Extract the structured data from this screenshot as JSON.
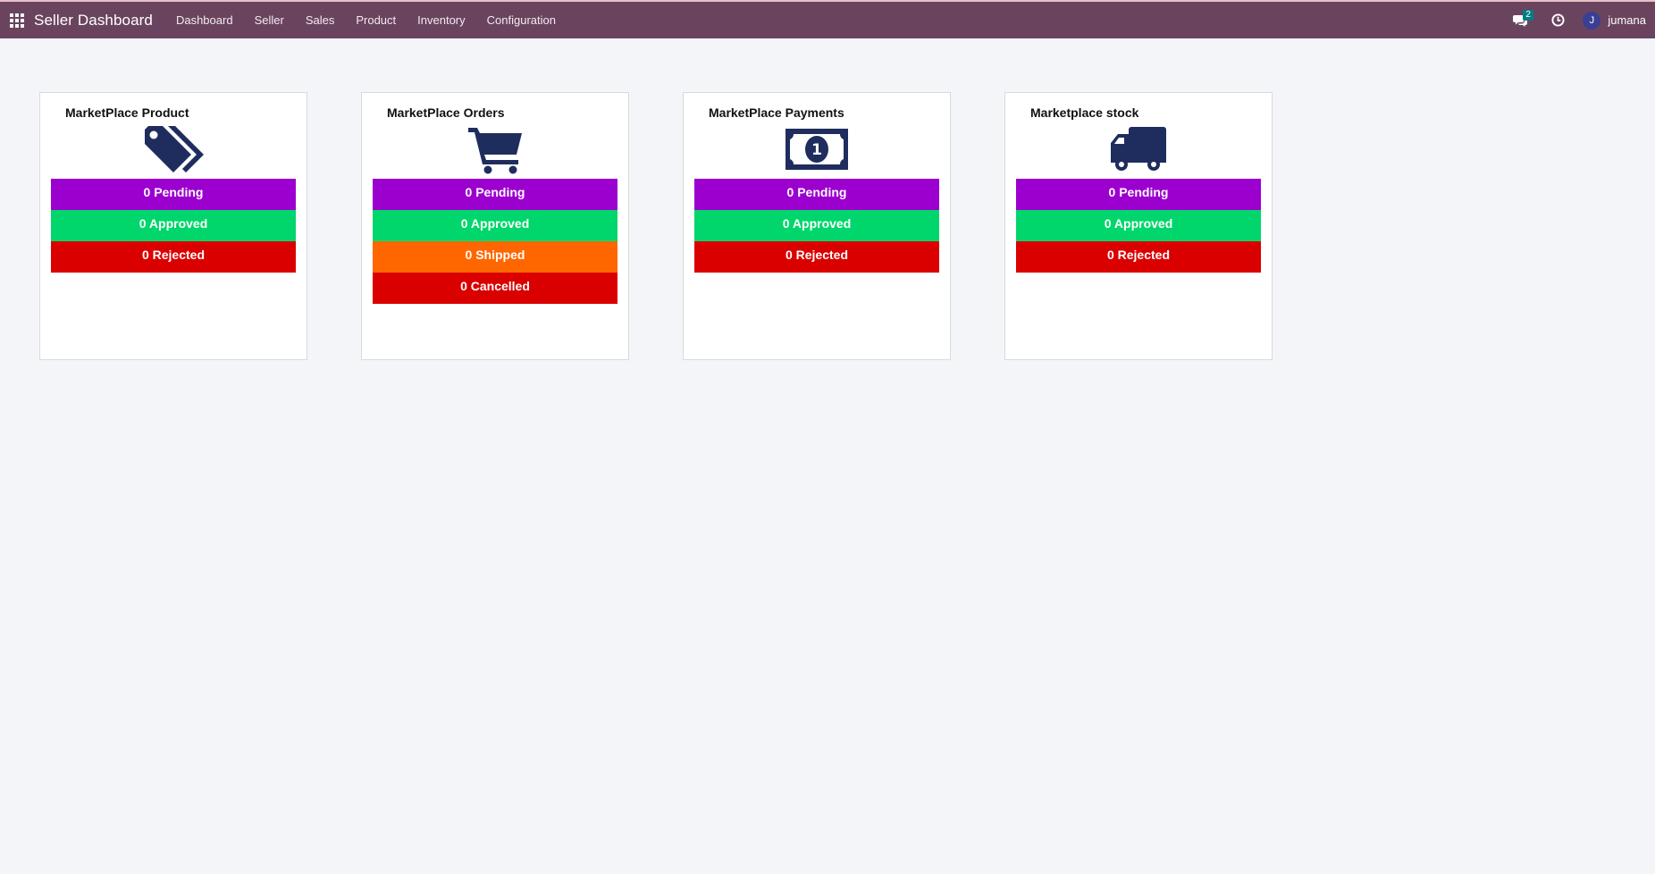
{
  "navbar": {
    "app_title": "Seller Dashboard",
    "menu": [
      {
        "label": "Dashboard"
      },
      {
        "label": "Seller"
      },
      {
        "label": "Sales"
      },
      {
        "label": "Product"
      },
      {
        "label": "Inventory"
      },
      {
        "label": "Configuration"
      }
    ],
    "chat_count": "2",
    "user_initial": "J",
    "user_name": "jumana",
    "icons": [
      "apps-grid-icon",
      "chat-icon",
      "clock-icon"
    ]
  },
  "cards": [
    {
      "title": "MarketPlace Product",
      "icon": "tags-icon",
      "stats": [
        {
          "label": "0 Pending",
          "status": "pending"
        },
        {
          "label": "0 Approved",
          "status": "approved"
        },
        {
          "label": "0 Rejected",
          "status": "rejected"
        }
      ]
    },
    {
      "title": "MarketPlace Orders",
      "icon": "shopping-cart-icon",
      "stats": [
        {
          "label": "0 Pending",
          "status": "pending"
        },
        {
          "label": "0 Approved",
          "status": "approved"
        },
        {
          "label": "0 Shipped",
          "status": "shipped"
        },
        {
          "label": "0 Cancelled",
          "status": "cancelled"
        }
      ]
    },
    {
      "title": "MarketPlace Payments",
      "icon": "money-bill-icon",
      "stats": [
        {
          "label": "0 Pending",
          "status": "pending"
        },
        {
          "label": "0 Approved",
          "status": "approved"
        },
        {
          "label": "0 Rejected",
          "status": "rejected"
        }
      ]
    },
    {
      "title": "Marketplace stock",
      "icon": "truck-icon",
      "stats": [
        {
          "label": "0 Pending",
          "status": "pending"
        },
        {
          "label": "0 Approved",
          "status": "approved"
        },
        {
          "label": "0 Rejected",
          "status": "rejected"
        }
      ]
    }
  ],
  "colors": {
    "navbar": "#6a445f",
    "pending": "#9b00cf",
    "approved": "#00d66b",
    "shipped": "#ff6600",
    "rejected": "#db0000",
    "icon": "#1f2d5e"
  }
}
